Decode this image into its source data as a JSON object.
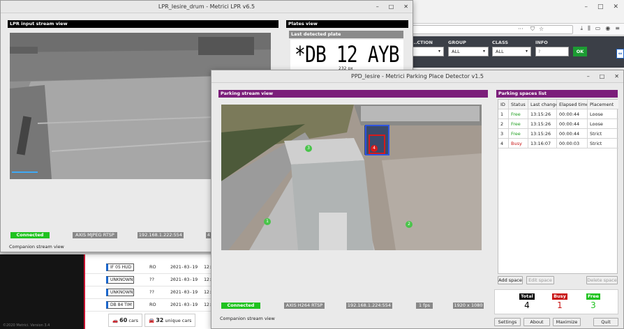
{
  "bg": {
    "footer": "©2020 Metrici. Version 3.4",
    "filters": [
      {
        "label": "...CTION",
        "value": ""
      },
      {
        "label": "GROUP",
        "value": "ALL"
      },
      {
        "label": "CLASS",
        "value": "ALL"
      },
      {
        "label": "INFO",
        "value": "?"
      }
    ],
    "ok_label": "OK",
    "plates": [
      {
        "plate": "IF 05 HUD",
        "country": "RO",
        "date": "2021-03-19",
        "time": "12:"
      },
      {
        "plate": "UNKNOWN",
        "country": "??",
        "date": "2021-03-19",
        "time": "12:"
      },
      {
        "plate": "UNKNOWN",
        "country": "??",
        "date": "2021-03-19",
        "time": "12:"
      },
      {
        "plate": "DB 84 TIM",
        "country": "RO",
        "date": "2021-03-19",
        "time": "12:"
      }
    ],
    "cars_count": "60",
    "cars_label": "cars",
    "unique_count": "32",
    "unique_label": "unique cars"
  },
  "lpr": {
    "title": "LPR_Iesire_drum - Metrici LPR v6.5",
    "input_panel": "LPR input stream view",
    "plates_panel": "Plates view",
    "last_plate_label": "Last detected plate",
    "plate_text": "*DB 12 AYB",
    "plate_px": "232 px",
    "status": "Connected",
    "camera": "AXIS MJPEG RTSP",
    "ip": "192.168.1.222:554",
    "extra": "4",
    "companion": "Companion stream view"
  },
  "ppd": {
    "title": "PPD_Iesire - Metrici Parking Place Detector v1.5",
    "stream_panel": "Parking stream view",
    "list_panel": "Parking spaces list",
    "columns": [
      "ID",
      "Status",
      "Last change",
      "Elapsed time",
      "Placement"
    ],
    "rows": [
      {
        "id": "1",
        "status": "Free",
        "change": "13:15:26",
        "elapsed": "00:00:44",
        "placement": "Loose"
      },
      {
        "id": "2",
        "status": "Free",
        "change": "13:15:26",
        "elapsed": "00:00:44",
        "placement": "Loose"
      },
      {
        "id": "3",
        "status": "Free",
        "change": "13:15:26",
        "elapsed": "00:00:44",
        "placement": "Strict"
      },
      {
        "id": "4",
        "status": "Busy",
        "change": "13:16:07",
        "elapsed": "00:00:03",
        "placement": "Strict"
      }
    ],
    "add_space": "Add space",
    "edit_space": "Edit space",
    "delete_space": "Delete space",
    "total_label": "Total",
    "total_value": "4",
    "busy_label": "Busy",
    "busy_value": "1",
    "free_label": "Free",
    "free_value": "3",
    "status": "Connected",
    "camera": "AXIS H264 RTSP",
    "ip": "192.168.1.224:554",
    "fps": "1 fps",
    "resolution": "1920 x 1080",
    "companion": "Companion stream view",
    "settings": "Settings",
    "about": "About",
    "maximize": "Maximize",
    "quit": "Quit",
    "markers": [
      "1",
      "2",
      "3",
      "4"
    ]
  },
  "colors": {
    "purple": "#7b1e7a",
    "green": "#1fc21f",
    "busy": "#c81414",
    "free": "#1d9e1d"
  }
}
